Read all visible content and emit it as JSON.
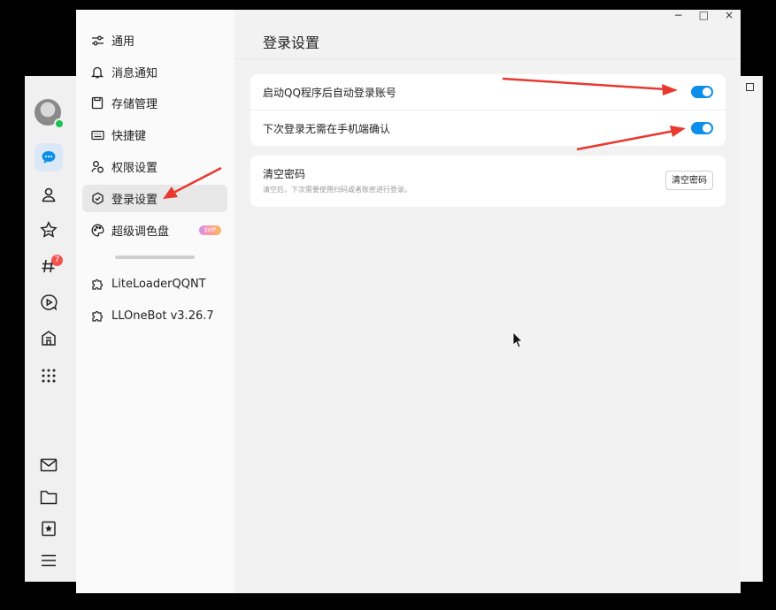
{
  "window_controls": {
    "minimize": "−",
    "maximize": "□",
    "close": "×"
  },
  "main_rail": {
    "icons": [
      "avatar",
      "chat-icon",
      "contacts-icon",
      "favorites-icon",
      "channel-icon",
      "video-icon",
      "game-center-icon",
      "more-apps-icon",
      "mail-icon",
      "folder-icon",
      "bookmark-icon",
      "menu-icon"
    ],
    "channel_badge": "7"
  },
  "settings": {
    "nav": {
      "items": [
        {
          "label": "通用",
          "icon": "sliders-icon"
        },
        {
          "label": "消息通知",
          "icon": "bell-icon"
        },
        {
          "label": "存储管理",
          "icon": "storage-icon"
        },
        {
          "label": "快捷键",
          "icon": "keyboard-icon"
        },
        {
          "label": "权限设置",
          "icon": "permission-icon"
        },
        {
          "label": "登录设置",
          "icon": "shield-check-icon",
          "active": true
        },
        {
          "label": "超级调色盘",
          "icon": "palette-icon",
          "badge": "SVIP"
        }
      ],
      "plugins": [
        {
          "label": "LiteLoaderQQNT",
          "icon": "puzzle-icon"
        },
        {
          "label": "LLOneBot v3.26.7",
          "icon": "puzzle-icon"
        }
      ]
    },
    "page": {
      "title": "登录设置",
      "auto_login_label": "启动QQ程序后自动登录账号",
      "auto_login_on": true,
      "no_phone_confirm_label": "下次登录无需在手机端确认",
      "no_phone_confirm_on": true,
      "clear_password_title": "清空密码",
      "clear_password_desc": "清空后，下次需要使用扫码或者账密进行登录。",
      "clear_password_button": "清空密码"
    }
  },
  "colors": {
    "accent": "#0d8fe9",
    "annotation_arrow": "#e8392f"
  }
}
